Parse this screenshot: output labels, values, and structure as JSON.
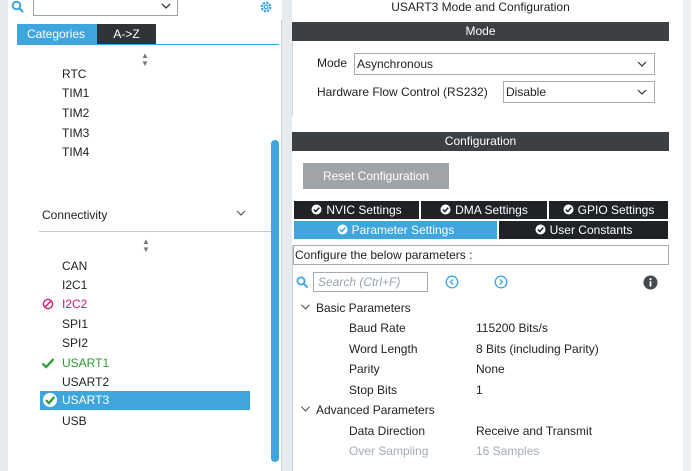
{
  "left": {
    "tabs": {
      "categories": "Categories",
      "atoz": "A->Z"
    },
    "timers": [
      "RTC",
      "TIM1",
      "TIM2",
      "TIM3",
      "TIM4"
    ],
    "section": "Connectivity",
    "connectivity": [
      {
        "label": "CAN",
        "status": "none"
      },
      {
        "label": "I2C1",
        "status": "none"
      },
      {
        "label": "I2C2",
        "status": "disabled"
      },
      {
        "label": "SPI1",
        "status": "none"
      },
      {
        "label": "SPI2",
        "status": "none"
      },
      {
        "label": "USART1",
        "status": "ok"
      },
      {
        "label": "USART2",
        "status": "none"
      },
      {
        "label": "USART3",
        "status": "selected"
      },
      {
        "label": "USB",
        "status": "none"
      }
    ]
  },
  "right": {
    "title": "USART3 Mode and Configuration",
    "mode_band": "Mode",
    "mode": {
      "label": "Mode",
      "value": "Asynchronous"
    },
    "flow": {
      "label": "Hardware Flow Control (RS232)",
      "value": "Disable"
    },
    "config_band": "Configuration",
    "reset_label": "Reset Configuration",
    "tabs_row1": [
      "NVIC Settings",
      "DMA Settings",
      "GPIO Settings"
    ],
    "tabs_row2": [
      "Parameter Settings",
      "User Constants"
    ],
    "params_title": "Configure the below parameters :",
    "search_placeholder": "Search (Ctrl+F)",
    "basic": {
      "title": "Basic Parameters",
      "rows": [
        {
          "label": "Baud Rate",
          "value": "115200 Bits/s"
        },
        {
          "label": "Word Length",
          "value": "8 Bits (including Parity)"
        },
        {
          "label": "Parity",
          "value": "None"
        },
        {
          "label": "Stop Bits",
          "value": "1"
        }
      ]
    },
    "advanced": {
      "title": "Advanced Parameters",
      "rows": [
        {
          "label": "Data Direction",
          "value": "Receive and Transmit"
        },
        {
          "label": "Over Sampling",
          "value": "16 Samples"
        }
      ]
    }
  },
  "colors": {
    "accent": "#3ea6dc",
    "dark": "#3b4045",
    "ok": "#2a9a32",
    "disabled": "#d0206c"
  }
}
